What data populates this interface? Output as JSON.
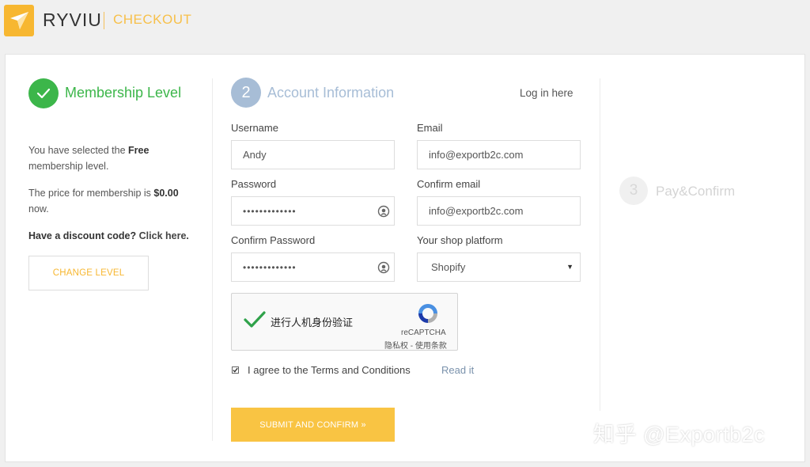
{
  "header": {
    "brand": "RYVIU",
    "section": "CHECKOUT"
  },
  "step1": {
    "title": "Membership Level",
    "selected_text_before": "You have selected the ",
    "selected_level": "Free",
    "selected_text_after": " membership level.",
    "price_text_before": "The price for membership is ",
    "price": "$0.00",
    "price_text_after": " now.",
    "discount_question": "Have a discount code?",
    "discount_link": "Click here.",
    "change_level_button": "CHANGE LEVEL"
  },
  "step2": {
    "number": "2",
    "title": "Account Information",
    "login_link": "Log in here",
    "username_label": "Username",
    "username_value": "Andy",
    "email_label": "Email",
    "email_value": "info@exportb2c.com",
    "password_label": "Password",
    "password_value": "•••••••••••••",
    "confirm_email_label": "Confirm email",
    "confirm_email_value": "info@exportb2c.com",
    "confirm_password_label": "Confirm Password",
    "confirm_password_value": "•••••••••••••",
    "platform_label": "Your shop platform",
    "platform_value": "Shopify",
    "captcha_text": "进行人机身份验证",
    "captcha_brand": "reCAPTCHA",
    "captcha_links": "隐私权 - 使用条款",
    "terms_text": "I agree to the Terms and Conditions",
    "terms_checked": true,
    "read_it": "Read it",
    "submit_button": "SUBMIT AND CONFIRM »"
  },
  "step3": {
    "number": "3",
    "title": "Pay&Confirm"
  },
  "watermark": "知乎 @Exportb2c",
  "colors": {
    "accent_yellow": "#f7b731",
    "success_green": "#3cb64a",
    "step_blue": "#a7bdd6"
  }
}
